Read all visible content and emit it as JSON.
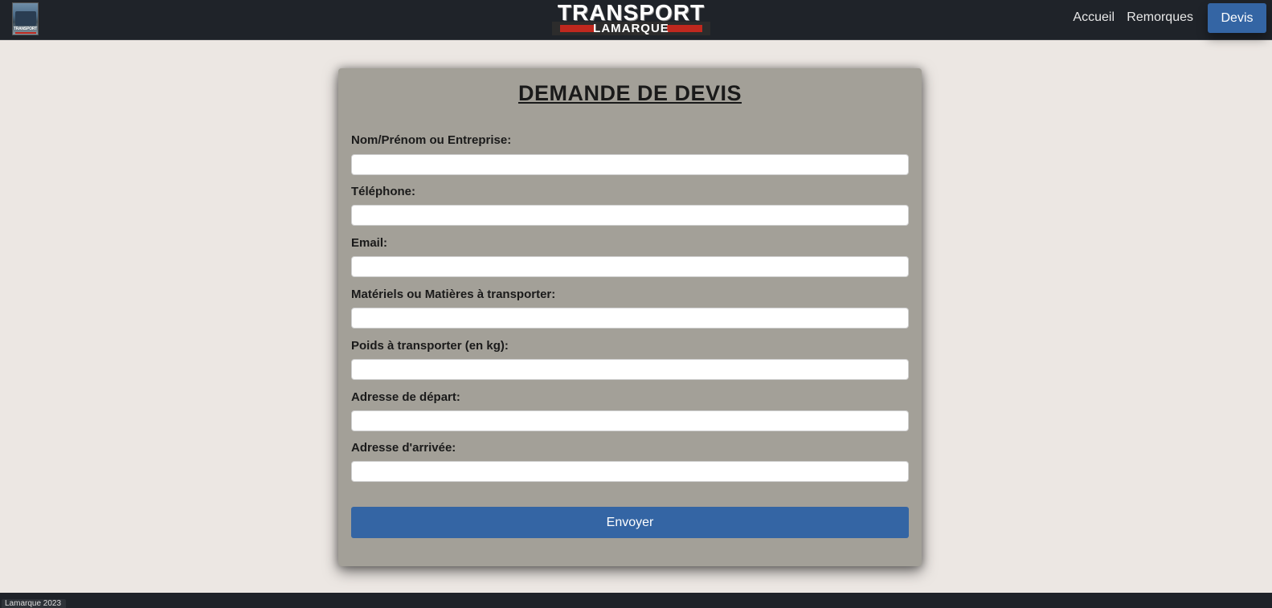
{
  "brand": {
    "title": "TRANSPORT",
    "subtitle": "LAMARQUE",
    "thumb_text": "TRANSPORT"
  },
  "nav": {
    "items": [
      {
        "label": "Accueil"
      },
      {
        "label": "Remorques"
      },
      {
        "label": "Devis",
        "active": true
      }
    ]
  },
  "form": {
    "title": "DEMANDE DE DEVIS",
    "fields": [
      {
        "label": "Nom/Prénom ou Entreprise:",
        "value": "",
        "placeholder": ""
      },
      {
        "label": "Téléphone:",
        "value": "",
        "placeholder": ""
      },
      {
        "label": "Email:",
        "value": "",
        "placeholder": ""
      },
      {
        "label": "Matériels ou Matières à transporter:",
        "value": "",
        "placeholder": ""
      },
      {
        "label": "Poids à transporter (en kg):",
        "value": "",
        "placeholder": ""
      },
      {
        "label": "Adresse de départ:",
        "value": "",
        "placeholder": ""
      },
      {
        "label": "Adresse d'arrivée:",
        "value": "",
        "placeholder": ""
      }
    ],
    "submit_label": "Envoyer"
  },
  "footer": {
    "text": "Lamarque 2023"
  },
  "colors": {
    "navbar": "#1f2329",
    "accent": "#3465a4",
    "card": "#a3a098",
    "page_bg": "#ece7e3"
  }
}
